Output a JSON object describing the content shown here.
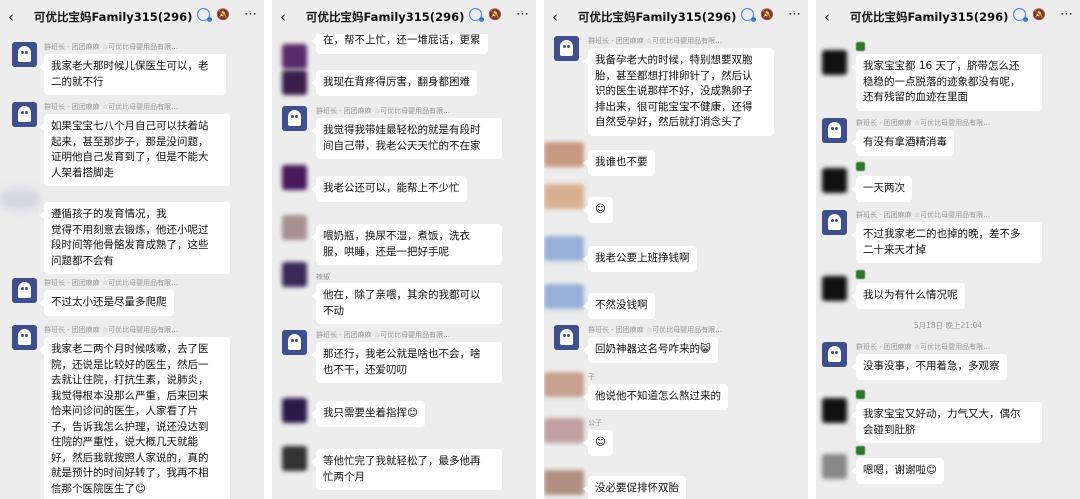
{
  "header": {
    "back_icon": "chevron-left",
    "title": "可优比宝妈Family315(296)",
    "chat_icon": "chat-bubble-icon",
    "mute_icon": "bell-off-icon",
    "more_icon": "⋯"
  },
  "panel1": {
    "messages": [
      {
        "nick": "群班长 · 团团麻麻 ☆可优比母婴用品有限…",
        "text": "我家老大那时候儿保医生可以，老\n二的就不行"
      },
      {
        "nick": "群班长 · 团团麻麻 ☆可优比母婴用品有限…",
        "text": "如果宝宝七八个月自己可以扶着站\n起来，甚至那步子，那是没问题，\n证明他自己发育到了，但是不能大\n人架着搭脚走"
      },
      {
        "nick": "",
        "text": "遵循孩子的发育情况，我\n觉得不用刻意去锻炼，他还小呢过\n段时间等他骨骼发育成熟了，这些\n问题都不会有"
      },
      {
        "nick": "群班长 · 团团麻麻 ☆可优比母婴用品有限…",
        "text": "不过太小还是尽量多爬爬"
      },
      {
        "nick": "群班长 · 团团麻麻 ☆可优比母婴用品有限…",
        "text": "我家老二两个月时候咳嗽，去了医\n院，还说是比较好的医生，然后一\n去就让住院，打抗生素，说肺炎，\n我觉得根本没那么严重，后来回来\n恰来问诊问的医生，人家看了片\n子，告诉我怎么护理，说还没达到\n住院的严重性，说大概几天就能\n好，然后我就按照人家说的，真的\n就是预计的时间好转了，我再不相\n信那个医院医生了😊"
      }
    ]
  },
  "panel2": {
    "messages": [
      {
        "nick": "",
        "text": "在，帮不上忙，还一堆屁话，更累"
      },
      {
        "nick": "",
        "text": "我现在背疼得厉害，翻身都困难"
      },
      {
        "nick": "群班长 · 团团麻麻 ☆可优比母婴用品有限…",
        "text": "我觉得我带娃最轻松的就是有段时\n间自己带，我老公天天忙的不在家"
      },
      {
        "nick": "",
        "text": "我老公还可以，能帮上不少忙"
      },
      {
        "nick": "",
        "text": "喂奶瓶，换尿不湿，煮饭，洗衣\n服，哄睡，还是一把好手呢"
      },
      {
        "nick": "辣椒",
        "text": "他在，除了亲喂，其余的我都可以\n不动"
      },
      {
        "nick": "群班长 · 团团麻麻 ☆可优比母婴用品有限…",
        "text": "那还行，我老公就是啥也不会，啥\n也不干，还爱叨叨"
      },
      {
        "nick": "",
        "text": "我只需要坐着指挥😊"
      },
      {
        "nick": "",
        "text": "等他忙完了我就轻松了，最多他再\n忙两个月"
      }
    ]
  },
  "panel3": {
    "messages": [
      {
        "nick": "群班长 · 团团麻麻 ☆可优比母婴用品有限…",
        "text": "我备孕老大的时候，特别想要双胞\n胎，甚至都想打排卵针了，然后认\n识的医生说那样不好，没成熟卵子\n排出来，很可能宝宝不健康，还得\n自然受孕好，然后就打消念头了"
      },
      {
        "nick": "",
        "text": "我谁也不要"
      },
      {
        "nick": "",
        "text": "😊"
      },
      {
        "nick": "",
        "text": "我老公要上班挣钱啊"
      },
      {
        "nick": "",
        "text": "不然没钱啊"
      },
      {
        "nick": "群班长 · 团团麻麻 ☆可优比母婴用品有限…",
        "text": "回奶神器这名号咋来的😸"
      },
      {
        "nick": "子",
        "text": "他说他不知道怎么熬过来的"
      },
      {
        "nick": "公子",
        "text": "😊"
      },
      {
        "nick": "",
        "text": "没必要促排怀双胎"
      }
    ]
  },
  "panel4": {
    "time": "5月18日 晚上21:04",
    "messages": [
      {
        "nick": "",
        "text": "我家宝宝都 16 天了，脐带怎么还\n稳稳的一点脱落的迹象都没有呢，\n还有残留的血迹在里面"
      },
      {
        "nick": "群班长 · 团团麻麻 ☆可优比母婴用品有限…",
        "text": "有没有拿酒精消毒"
      },
      {
        "nick": "",
        "text": "一天两次"
      },
      {
        "nick": "群班长 · 团团麻麻 ☆可优比母婴用品有限…",
        "text": "不过我家老二的也掉的晚，差不多\n二十来天才掉"
      },
      {
        "nick": "",
        "text": "我以为有什么情况呢"
      },
      {
        "nick": "群班长 · 团团麻麻 ☆可优比母婴用品有限…",
        "text": "没事没事，不用着急，多观察"
      },
      {
        "nick": "",
        "text": "我家宝宝又好动，力气又大，偶尔\n会碰到肚脐"
      },
      {
        "nick": "",
        "text": "嗯嗯，谢谢啦😊"
      }
    ]
  },
  "colors": {
    "bg": "#ededed",
    "bubble": "#ffffff",
    "avatar": "#3f4f8c",
    "accent": "#3a79d6"
  }
}
